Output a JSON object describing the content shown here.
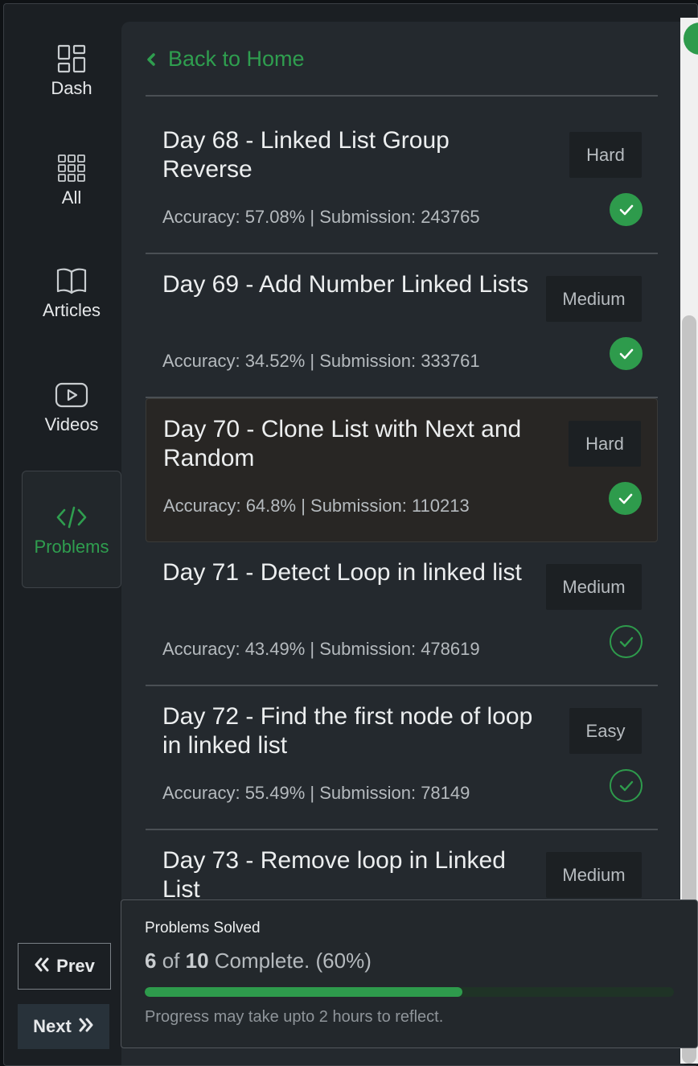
{
  "sidebar": {
    "items": [
      {
        "label": "Dash",
        "icon": "dashboard-icon"
      },
      {
        "label": "All",
        "icon": "grid-icon"
      },
      {
        "label": "Articles",
        "icon": "book-icon"
      },
      {
        "label": "Videos",
        "icon": "video-icon"
      },
      {
        "label": "Problems",
        "icon": "code-icon",
        "active": true
      }
    ],
    "prev_label": "Prev",
    "next_label": "Next"
  },
  "header": {
    "back_label": "Back to Home"
  },
  "problems": [
    {
      "title": "Day 68 - Linked List Group Reverse",
      "stats": "Accuracy: 57.08% | Submission: 243765",
      "difficulty": "Hard",
      "status": "solved"
    },
    {
      "title": "Day 69 - Add Number Linked Lists",
      "stats": "Accuracy: 34.52% | Submission: 333761",
      "difficulty": "Medium",
      "status": "solved"
    },
    {
      "title": "Day 70 - Clone List with Next and Random",
      "stats": "Accuracy: 64.8% | Submission: 110213",
      "difficulty": "Hard",
      "status": "solved"
    },
    {
      "title": "Day 71 - Detect Loop in linked list",
      "stats": "Accuracy: 43.49% | Submission: 478619",
      "difficulty": "Medium",
      "status": "attempted"
    },
    {
      "title": "Day 72 - Find the first node of loop in linked list",
      "stats": "Accuracy: 55.49% | Submission: 78149",
      "difficulty": "Easy",
      "status": "attempted"
    },
    {
      "title": "Day 73 - Remove loop in Linked List",
      "stats": "",
      "difficulty": "Medium",
      "status": ""
    }
  ],
  "progress": {
    "label": "Problems Solved",
    "solved": "6",
    "of_word": "of",
    "total": "10",
    "suffix": "Complete. (60%)",
    "fraction": 0.6,
    "note": "Progress may take upto 2 hours to reflect."
  },
  "colors": {
    "accent": "#2e9b4c",
    "background": "#1b1f23",
    "panel": "#24292e"
  }
}
